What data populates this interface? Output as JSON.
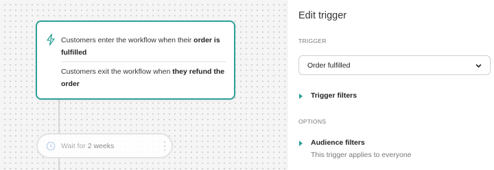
{
  "workflow": {
    "trigger": {
      "enter_text": "Customers enter the workflow when their ",
      "enter_bold": "order is fulfilled",
      "exit_text": "Customers exit the workflow when ",
      "exit_bold": "they refund the order"
    },
    "wait_step": {
      "prefix": "Wait for ",
      "duration": "2 weeks"
    }
  },
  "panel": {
    "title": "Edit trigger",
    "trigger_section_label": "TRIGGER",
    "trigger_select": {
      "value": "Order fulfilled"
    },
    "trigger_filters_label": "Trigger filters",
    "options_section_label": "OPTIONS",
    "audience_filters_label": "Audience filters",
    "audience_hint": "This trigger applies to everyone"
  },
  "colors": {
    "accent": "#2aa198",
    "canvas_bg": "#f5f5f5"
  },
  "icons": [
    "lightning-bolt-icon",
    "clock-icon",
    "kebab-menu-icon",
    "chevron-down-icon",
    "expand-triangle-icon"
  ]
}
